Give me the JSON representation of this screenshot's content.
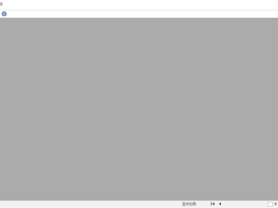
{
  "title_strip": {
    "text": "0"
  },
  "toolbar": {
    "globe_icon": "globe-icon"
  },
  "status": {
    "text": "显示比例",
    "first_icon": "first-page-icon",
    "prev_icon": "previous-page-icon",
    "zoom_label": "8"
  },
  "colors": {
    "canvas": "#ababab",
    "toolbar": "#ffffff",
    "statusbar": "#f2f2f2"
  }
}
